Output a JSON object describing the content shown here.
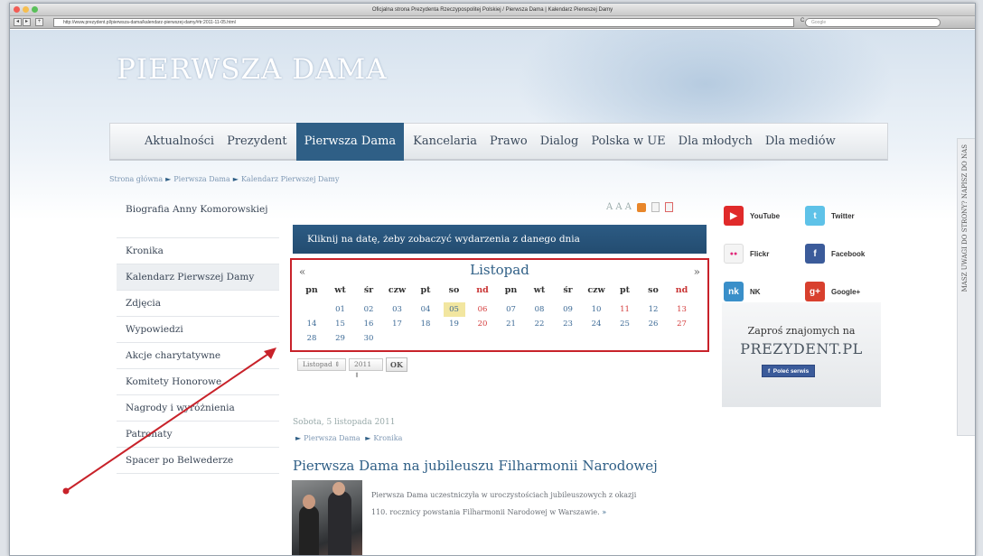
{
  "browser": {
    "title": "Oficjalna strona Prezydenta Rzeczypospolitej Polskiej / Pierwsza Dama | Kalendarz Pierwszej Damy",
    "url": "http://www.prezydent.pl/pierwsza-dama/kalendarz-pierwszej-damy/#tr:2011-11-05.html",
    "search_placeholder": "Google",
    "reload": "C"
  },
  "site": {
    "title": "PIERWSZA DAMA"
  },
  "nav": [
    {
      "label": "Aktualności",
      "active": false
    },
    {
      "label": "Prezydent",
      "active": false
    },
    {
      "label": "Pierwsza Dama",
      "active": true
    },
    {
      "label": "Kancelaria",
      "active": false
    },
    {
      "label": "Prawo",
      "active": false
    },
    {
      "label": "Dialog",
      "active": false
    },
    {
      "label": "Polska w UE",
      "active": false
    },
    {
      "label": "Dla młodych",
      "active": false
    },
    {
      "label": "Dla mediów",
      "active": false
    }
  ],
  "breadcrumb": [
    "Strona główna",
    "Pierwsza Dama",
    "Kalendarz Pierwszej Damy"
  ],
  "breadcrumb_sep": "►",
  "sidebar_left": [
    "Biografia Anny Komorowskiej",
    "Kronika",
    "Kalendarz Pierwszej Damy",
    "Zdjęcia",
    "Wypowiedzi",
    "Akcje charytatywne",
    "Komitety Honorowe",
    "Nagrody i wyróżnienia",
    "Patronaty",
    "Spacer po Belwederze"
  ],
  "tools": {
    "font_size": "A A A"
  },
  "calendar": {
    "header": "Kliknij na datę, żeby zobaczyć wydarzenia z danego dnia",
    "month": "Listopad",
    "prev": "«",
    "next": "»",
    "weekdays": [
      "pn",
      "wt",
      "śr",
      "czw",
      "pt",
      "so",
      "nd",
      "pn",
      "wt",
      "śr",
      "czw",
      "pt",
      "so",
      "nd"
    ],
    "weeks": [
      [
        "",
        "01",
        "02",
        "03",
        "04",
        "05",
        "06",
        "07",
        "08",
        "09",
        "10",
        "11",
        "12",
        "13"
      ],
      [
        "14",
        "15",
        "16",
        "17",
        "18",
        "19",
        "20",
        "21",
        "22",
        "23",
        "24",
        "25",
        "26",
        "27"
      ],
      [
        "28",
        "29",
        "30",
        "",
        "",
        "",
        "",
        "",
        "",
        "",
        "",
        "",
        "",
        ""
      ]
    ],
    "today": "05",
    "select_month": "Listopad",
    "select_year": "2011",
    "ok": "OK"
  },
  "event": {
    "date": "Sobota, 5 listopada 2011",
    "categories": [
      "Pierwsza Dama",
      "Kronika"
    ],
    "title": "Pierwsza Dama na jubileuszu Filharmonii Narodowej",
    "text": "Pierwsza Dama uczestniczyła w uroczystościach jubileuszowych z okazji 110. rocznicy powstania Filharmonii Narodowej w Warszawie.",
    "more": "»"
  },
  "social": [
    {
      "label": "YouTube",
      "icon": "youtube-icon",
      "color": "#e02a2a",
      "glyph": "▶"
    },
    {
      "label": "Twitter",
      "icon": "twitter-icon",
      "color": "#5ec2e8",
      "glyph": "t"
    },
    {
      "label": "Flickr",
      "icon": "flickr-icon",
      "color": "#f4f4f4",
      "glyph": "●●"
    },
    {
      "label": "Facebook",
      "icon": "facebook-icon",
      "color": "#3b5b9a",
      "glyph": "f"
    },
    {
      "label": "NK",
      "icon": "nk-icon",
      "color": "#3a8fc9",
      "glyph": "nk"
    },
    {
      "label": "Google+",
      "icon": "google-plus-icon",
      "color": "#d8402e",
      "glyph": "g+"
    }
  ],
  "invite": {
    "line1": "Zaproś znajomych na",
    "site": "PREZYDENT.PL",
    "button": "Poleć serwis",
    "button_icon": "f"
  },
  "sidetab": {
    "label": "MASZ UWAGI DO STRONY? NAPISZ DO NAS"
  },
  "annotation": {
    "color": "#c8222a"
  }
}
